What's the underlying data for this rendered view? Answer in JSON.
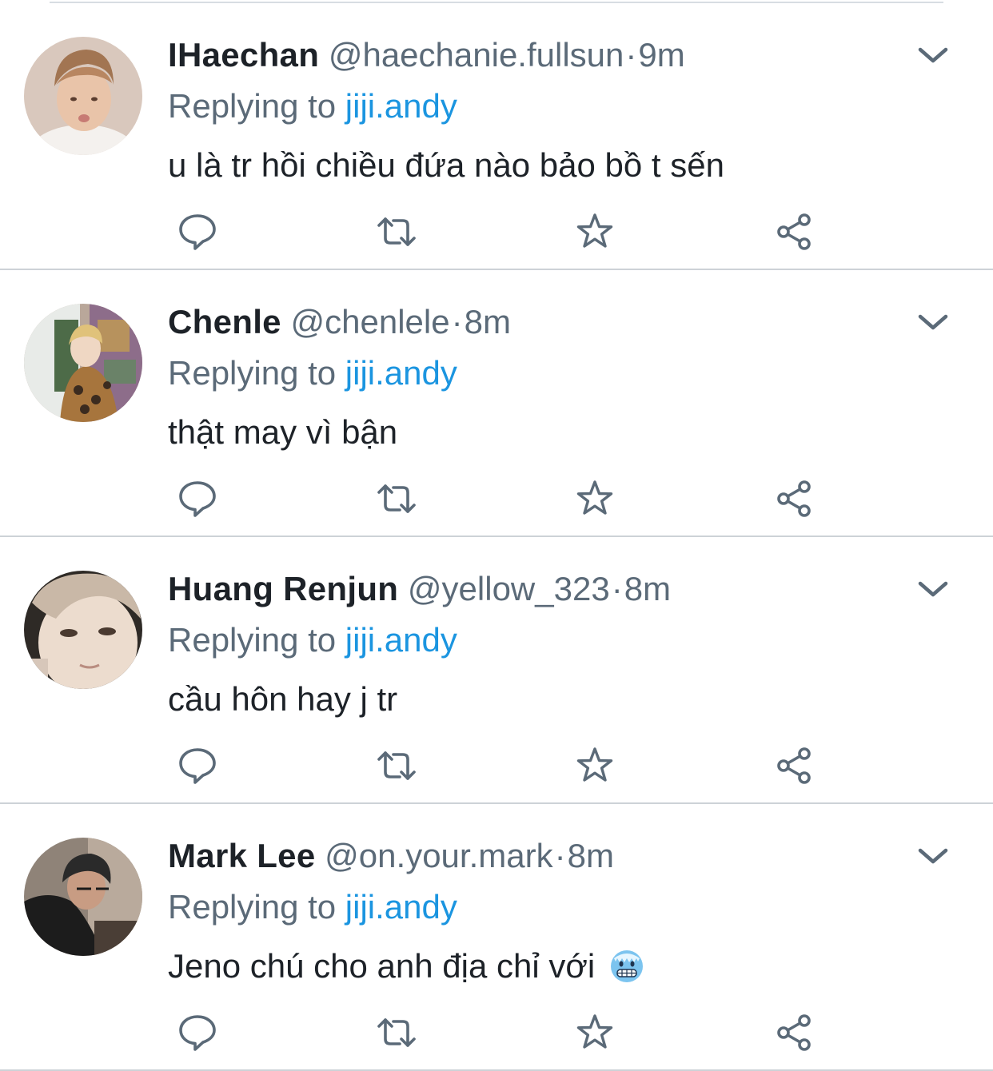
{
  "colors": {
    "name": "#1d2228",
    "muted": "#5b6a78",
    "link": "#1b95e0",
    "icon": "#5b6a78",
    "divider": "#cdd2d7"
  },
  "icons": {
    "reply": "reply-icon",
    "retweet": "retweet-icon",
    "like": "star-icon",
    "share": "share-icon",
    "menu": "chevron-down-icon"
  },
  "tweets": [
    {
      "name": "IHaechan",
      "handle": "@haechanie.fullsun",
      "dot": "·",
      "time": "9m",
      "replying_prefix": "Replying to ",
      "replying_to": "jiji.andy",
      "text": "u là tr hồi chiều đứa nào bảo bồ t sến"
    },
    {
      "name": " Chenle",
      "handle": "@chenlele",
      "dot": "·",
      "time": "8m",
      "replying_prefix": "Replying to ",
      "replying_to": "jiji.andy",
      "text": "thật may vì bận"
    },
    {
      "name": "Huang Renjun",
      "handle": "@yellow_323",
      "dot": "·",
      "time": "8m",
      "replying_prefix": "Replying to ",
      "replying_to": "jiji.andy",
      "text": "cầu hôn hay j tr"
    },
    {
      "name": "Mark Lee",
      "handle": "@on.your.mark",
      "dot": "·",
      "time": "8m",
      "replying_prefix": "Replying to ",
      "replying_to": "jiji.andy",
      "text": "Jeno chú cho anh địa chỉ với",
      "emoji": "freezing-face-emoji"
    }
  ]
}
